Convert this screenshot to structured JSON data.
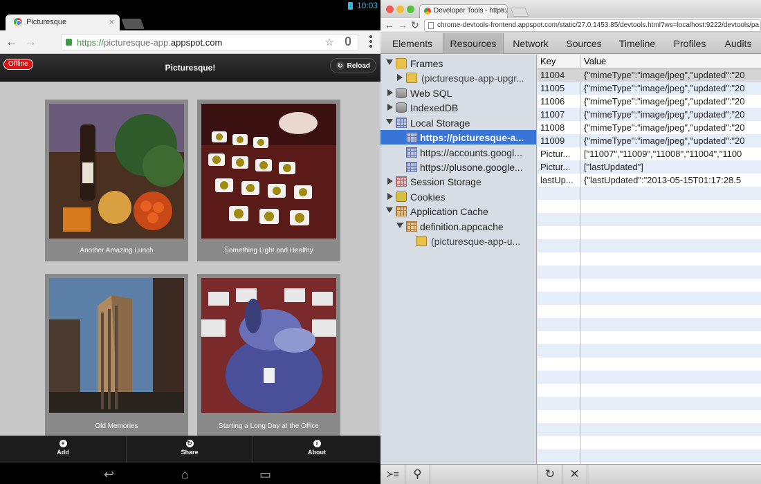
{
  "android": {
    "status": {
      "time": "10:03"
    },
    "browser_tab": {
      "title": "Picturesque",
      "close": "×"
    },
    "nav": {
      "back": "←",
      "forward": "→"
    },
    "url": {
      "scheme": "https://",
      "host_prefix": "picturesque-app.",
      "host": "appspot.com"
    },
    "url_icons": {
      "star": "☆"
    },
    "app": {
      "offline_badge": "Offline",
      "title": "Picturesque!",
      "reload_label": "Reload",
      "reload_icon": "↻"
    },
    "photos": [
      {
        "caption": "Another Amazing Lunch"
      },
      {
        "caption": "Something Light and Healthy"
      },
      {
        "caption": "Old Memories"
      },
      {
        "caption": "Starting a Long Day at the Office"
      }
    ],
    "bottom_nav": [
      {
        "icon": "+",
        "label": "Add"
      },
      {
        "icon": "↻",
        "label": "Share"
      },
      {
        "icon": "i",
        "label": "About"
      }
    ],
    "system_nav": {
      "back": "↩",
      "home": "⌂",
      "recents": "▭"
    }
  },
  "devtools": {
    "window_tab": {
      "title": "Developer Tools - https://",
      "close": "×"
    },
    "nav": {
      "back": "←",
      "forward": "→",
      "reload": "↻"
    },
    "url": "chrome-devtools-frontend.appspot.com/static/27.0.1453.85/devtools.html?ws=localhost:9222/devtools/pa",
    "tabs": [
      "Elements",
      "Resources",
      "Network",
      "Sources",
      "Timeline",
      "Profiles",
      "Audits"
    ],
    "active_tab": "Resources",
    "tree": [
      {
        "label": "Frames",
        "icon": "folder-icon"
      },
      {
        "label": "(picturesque-app-upgr...",
        "icon": "folder-icon"
      },
      {
        "label": "Web SQL",
        "icon": "database-icon"
      },
      {
        "label": "IndexedDB",
        "icon": "database-icon"
      },
      {
        "label": "Local Storage",
        "icon": "storage-grid-icon"
      },
      {
        "label": "https://picturesque-a...",
        "icon": "storage-grid-icon"
      },
      {
        "label": "https://accounts.googl...",
        "icon": "storage-grid-icon"
      },
      {
        "label": "https://plusone.google...",
        "icon": "storage-grid-icon"
      },
      {
        "label": "Session Storage",
        "icon": "storage-grid-icon"
      },
      {
        "label": "Cookies",
        "icon": "cookie-icon"
      },
      {
        "label": "Application Cache",
        "icon": "appcache-grid-icon"
      },
      {
        "label": "definition.appcache",
        "icon": "appcache-grid-icon"
      },
      {
        "label": "(picturesque-app-u...",
        "icon": "folder-icon"
      }
    ],
    "table": {
      "headers": {
        "key": "Key",
        "value": "Value"
      },
      "rows": [
        {
          "key": "11004",
          "value": "{\"mimeType\":\"image/jpeg\",\"updated\":\"20"
        },
        {
          "key": "11005",
          "value": "{\"mimeType\":\"image/jpeg\",\"updated\":\"20"
        },
        {
          "key": "11006",
          "value": "{\"mimeType\":\"image/jpeg\",\"updated\":\"20"
        },
        {
          "key": "11007",
          "value": "{\"mimeType\":\"image/jpeg\",\"updated\":\"20"
        },
        {
          "key": "11008",
          "value": "{\"mimeType\":\"image/jpeg\",\"updated\":\"20"
        },
        {
          "key": "11009",
          "value": "{\"mimeType\":\"image/jpeg\",\"updated\":\"20"
        },
        {
          "key": "Pictur...",
          "value": "[\"11007\",\"11009\",\"11008\",\"11004\",\"1100"
        },
        {
          "key": "Pictur...",
          "value": "[\"lastUpdated\"]"
        },
        {
          "key": "lastUp...",
          "value": "{\"lastUpdated\":\"2013-05-15T01:17:28.5"
        }
      ]
    },
    "status_buttons": [
      {
        "glyph": "≻≡"
      },
      {
        "glyph": "⚲"
      },
      {
        "glyph": "↻"
      },
      {
        "glyph": "✕"
      }
    ]
  },
  "colors": {
    "accent": "#33b5e5",
    "selection": "#3875d7",
    "offline_badge": "#dd1111"
  }
}
